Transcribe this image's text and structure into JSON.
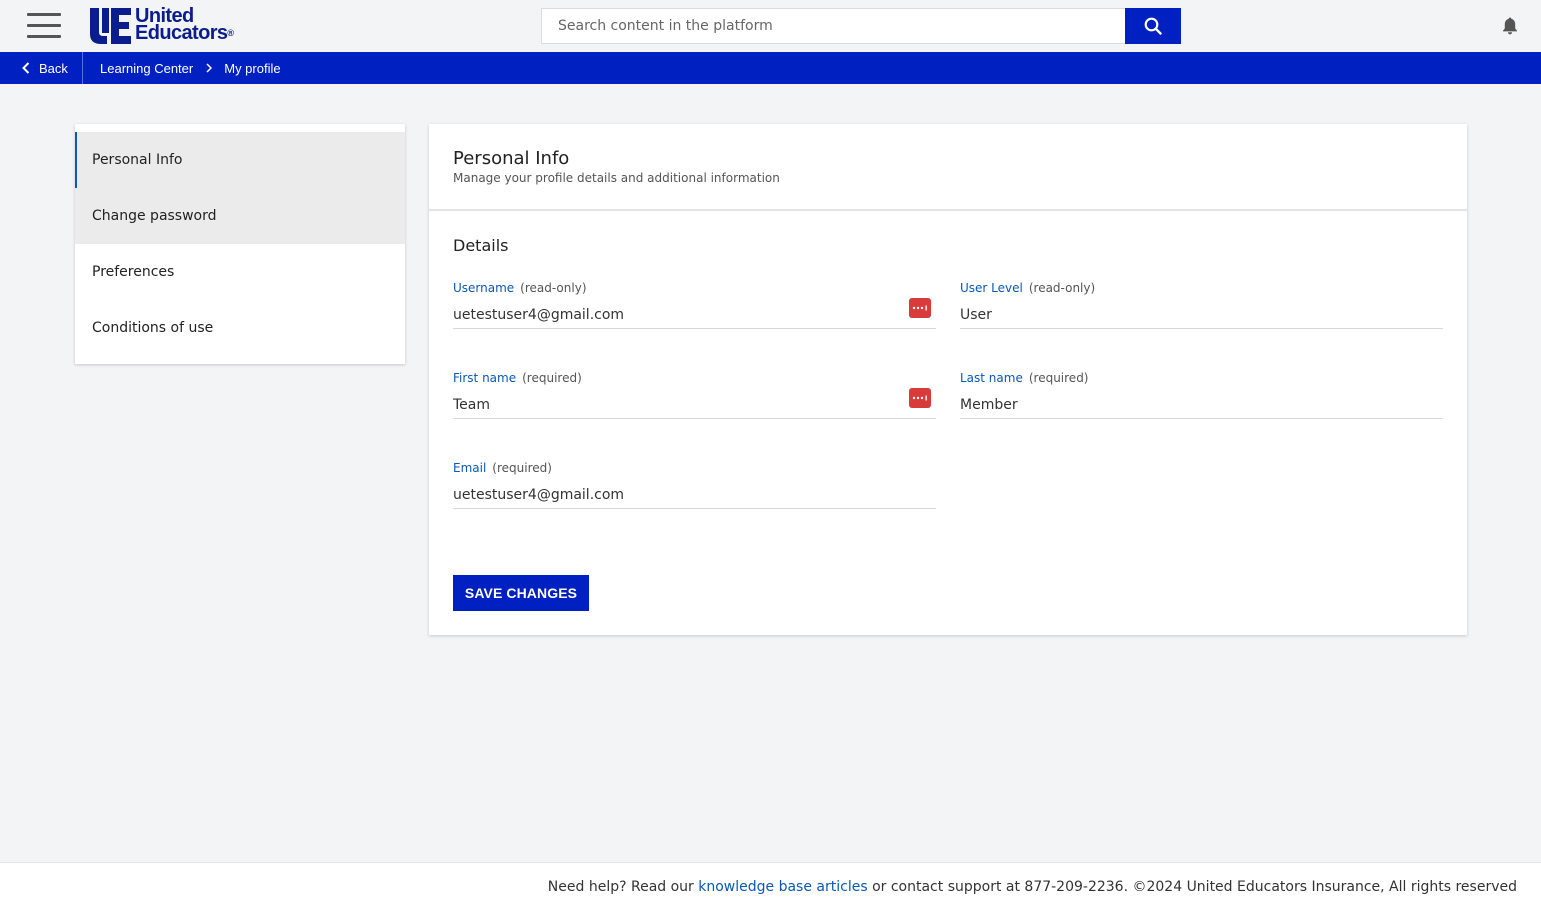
{
  "header": {
    "logo_line1": "United",
    "logo_line2": "Educators",
    "logo_reg": "®",
    "search_placeholder": "Search content in the platform"
  },
  "breadcrumb": {
    "back_label": "Back",
    "items": [
      "Learning Center",
      "My profile"
    ]
  },
  "sidenav": {
    "items": [
      {
        "label": "Personal Info",
        "state": "active"
      },
      {
        "label": "Change password",
        "state": "hover"
      },
      {
        "label": "Preferences",
        "state": "normal"
      },
      {
        "label": "Conditions of use",
        "state": "normal"
      }
    ]
  },
  "main": {
    "title": "Personal Info",
    "subtitle": "Manage your profile details and additional information",
    "section_title": "Details",
    "fields": {
      "username": {
        "label": "Username",
        "note": "(read-only)",
        "value": "uetestuser4@gmail.com"
      },
      "user_level": {
        "label": "User Level",
        "note": "(read-only)",
        "value": "User"
      },
      "first_name": {
        "label": "First name",
        "note": "(required)",
        "value": "Team"
      },
      "last_name": {
        "label": "Last name",
        "note": "(required)",
        "value": "Member"
      },
      "email": {
        "label": "Email",
        "note": "(required)",
        "value": "uetestuser4@gmail.com"
      }
    },
    "save_label": "SAVE CHANGES"
  },
  "footer": {
    "prefix": "Need help? Read our ",
    "link_text": "knowledge base articles",
    "suffix": " or contact support at 877-209-2236. ©2024 United Educators Insurance, All rights reserved"
  },
  "colors": {
    "brand_blue": "#0020c2",
    "link_blue": "#0a58b8",
    "password_manager_red": "#d93a3a",
    "page_bg": "#f3f4f5"
  },
  "icons": {
    "menu": "hamburger-icon",
    "search": "search-icon",
    "notifications": "bell-icon",
    "back": "chevron-left-icon",
    "crumb_separator": "chevron-right-icon",
    "password_manager": "password-manager-icon"
  }
}
